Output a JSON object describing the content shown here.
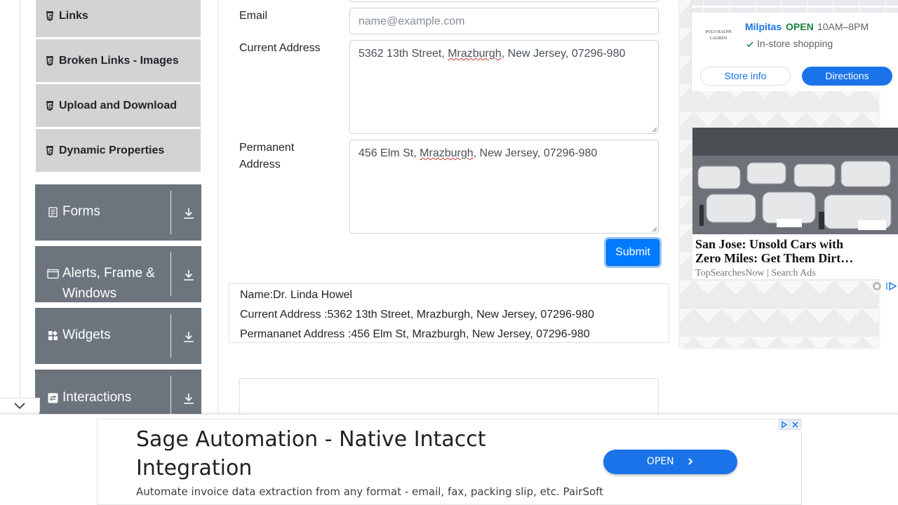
{
  "sidebar": {
    "sub_items": [
      {
        "label": "Links"
      },
      {
        "label": "Broken Links - Images"
      },
      {
        "label": "Upload and Download"
      },
      {
        "label": "Dynamic Properties"
      }
    ],
    "groups": [
      {
        "label": "Forms"
      },
      {
        "label": "Alerts, Frame &",
        "label2": "Windows"
      },
      {
        "label": "Widgets"
      },
      {
        "label": "Interactions"
      }
    ]
  },
  "form": {
    "email_label": "Email",
    "email_placeholder": "name@example.com",
    "current_address_label": "Current Address",
    "current_address_value": {
      "pre": "5362 13th Street, ",
      "misspelled": "Mrazburgh",
      "post": ", New Jersey, 07296-980"
    },
    "permanent_address_label_line1": "Permanent",
    "permanent_address_label_line2": "Address",
    "permanent_address_value": {
      "pre": "456 Elm St, ",
      "misspelled": "Mrazburgh",
      "post": ", New Jersey, 07296-980"
    },
    "submit_label": "Submit"
  },
  "output": {
    "name": "Name:Dr. Linda Howel",
    "current_address": "Current Address :5362 13th Street, Mrazburgh, New Jersey, 07296-980",
    "permanent_address": "Permananet Address :456 Elm St, Mrazburgh, New Jersey, 07296-980"
  },
  "side_ad": {
    "store_logo": "POLO RALPH LAUREN",
    "store_name": "Milpitas",
    "store_status": "OPEN",
    "store_hours": "10AM–8PM",
    "store_feature": "In-store shopping",
    "store_info_label": "Store info",
    "directions_label": "Directions",
    "car_headline_line1": "San Jose: Unsold Cars with",
    "car_headline_line2": "Zero Miles: Get Them Dirt…",
    "car_source": "TopSearchesNow | Search Ads"
  },
  "bottom_ad": {
    "title": "Sage Automation - Native Intacct Integration",
    "description": "Automate invoice data extraction from any format - email, fax, packing slip, etc. PairSoft",
    "open_label": "OPEN"
  },
  "colors": {
    "primary": "#007bff",
    "sidebar_group": "#6c757d",
    "sidebar_sub": "#d3d3d3",
    "ad_blue": "#1a73e8",
    "open_green": "#188038"
  }
}
